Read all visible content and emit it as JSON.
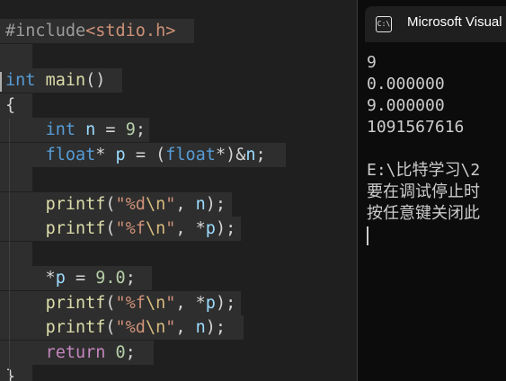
{
  "editor": {
    "lines": [
      [
        {
          "t": "#include",
          "c": "pp"
        },
        {
          "t": "<stdio.h>",
          "c": "inc"
        }
      ],
      [],
      [
        {
          "t": "int",
          "c": "kw"
        },
        {
          "t": " ",
          "c": "pl"
        },
        {
          "t": "main",
          "c": "fn"
        },
        {
          "t": "()",
          "c": "pl"
        }
      ],
      [
        {
          "t": "{",
          "c": "pl"
        }
      ],
      [
        {
          "t": "    ",
          "c": "pl"
        },
        {
          "t": "int",
          "c": "kw"
        },
        {
          "t": " ",
          "c": "pl"
        },
        {
          "t": "n",
          "c": "var"
        },
        {
          "t": " = ",
          "c": "pl"
        },
        {
          "t": "9",
          "c": "num"
        },
        {
          "t": ";",
          "c": "pl"
        }
      ],
      [
        {
          "t": "    ",
          "c": "pl"
        },
        {
          "t": "float",
          "c": "kw"
        },
        {
          "t": "* ",
          "c": "pl"
        },
        {
          "t": "p",
          "c": "var"
        },
        {
          "t": " = (",
          "c": "pl"
        },
        {
          "t": "float",
          "c": "kw"
        },
        {
          "t": "*)&",
          "c": "pl"
        },
        {
          "t": "n",
          "c": "var"
        },
        {
          "t": ";",
          "c": "pl"
        }
      ],
      [],
      [
        {
          "t": "    ",
          "c": "pl"
        },
        {
          "t": "printf",
          "c": "fn"
        },
        {
          "t": "(",
          "c": "pl"
        },
        {
          "t": "\"%d",
          "c": "str"
        },
        {
          "t": "\\n",
          "c": "esc"
        },
        {
          "t": "\"",
          "c": "str"
        },
        {
          "t": ", ",
          "c": "pl"
        },
        {
          "t": "n",
          "c": "var"
        },
        {
          "t": ");",
          "c": "pl"
        }
      ],
      [
        {
          "t": "    ",
          "c": "pl"
        },
        {
          "t": "printf",
          "c": "fn"
        },
        {
          "t": "(",
          "c": "pl"
        },
        {
          "t": "\"%f",
          "c": "str"
        },
        {
          "t": "\\n",
          "c": "esc"
        },
        {
          "t": "\"",
          "c": "str"
        },
        {
          "t": ", *",
          "c": "pl"
        },
        {
          "t": "p",
          "c": "var"
        },
        {
          "t": ");",
          "c": "pl"
        }
      ],
      [],
      [
        {
          "t": "    *",
          "c": "pl"
        },
        {
          "t": "p",
          "c": "var"
        },
        {
          "t": " = ",
          "c": "pl"
        },
        {
          "t": "9.0",
          "c": "num"
        },
        {
          "t": ";",
          "c": "pl"
        }
      ],
      [
        {
          "t": "    ",
          "c": "pl"
        },
        {
          "t": "printf",
          "c": "fn"
        },
        {
          "t": "(",
          "c": "pl"
        },
        {
          "t": "\"%f",
          "c": "str"
        },
        {
          "t": "\\n",
          "c": "esc"
        },
        {
          "t": "\"",
          "c": "str"
        },
        {
          "t": ", *",
          "c": "pl"
        },
        {
          "t": "p",
          "c": "var"
        },
        {
          "t": ");",
          "c": "pl"
        }
      ],
      [
        {
          "t": "    ",
          "c": "pl"
        },
        {
          "t": "printf",
          "c": "fn"
        },
        {
          "t": "(",
          "c": "pl"
        },
        {
          "t": "\"%d",
          "c": "str"
        },
        {
          "t": "\\n",
          "c": "esc"
        },
        {
          "t": "\"",
          "c": "str"
        },
        {
          "t": ", ",
          "c": "pl"
        },
        {
          "t": "n",
          "c": "var"
        },
        {
          "t": ");",
          "c": "pl"
        }
      ],
      [
        {
          "t": "    ",
          "c": "pl"
        },
        {
          "t": "return",
          "c": "ctl"
        },
        {
          "t": " ",
          "c": "pl"
        },
        {
          "t": "0",
          "c": "num"
        },
        {
          "t": ";",
          "c": "pl"
        }
      ],
      [
        {
          "t": "}",
          "c": "pl"
        }
      ]
    ]
  },
  "console": {
    "title": "Microsoft Visual",
    "icon": "console-app-icon",
    "icon_text": "C:\\",
    "lines": [
      "9",
      "0.000000",
      "9.000000",
      "1091567616",
      "",
      "E:\\比特学习\\2",
      "要在调试停止时",
      "按任意键关闭此"
    ]
  },
  "colors": {
    "editor_bg": "#1f1f1f",
    "selection": "#2e2e2e",
    "keyword": "#569cd6",
    "control": "#c586c0",
    "string": "#ce9178",
    "number": "#b5cea8",
    "variable": "#9cdcfe",
    "function": "#dcdcaa",
    "console_bg": "#0c0c0c",
    "console_text": "#cccccc"
  }
}
